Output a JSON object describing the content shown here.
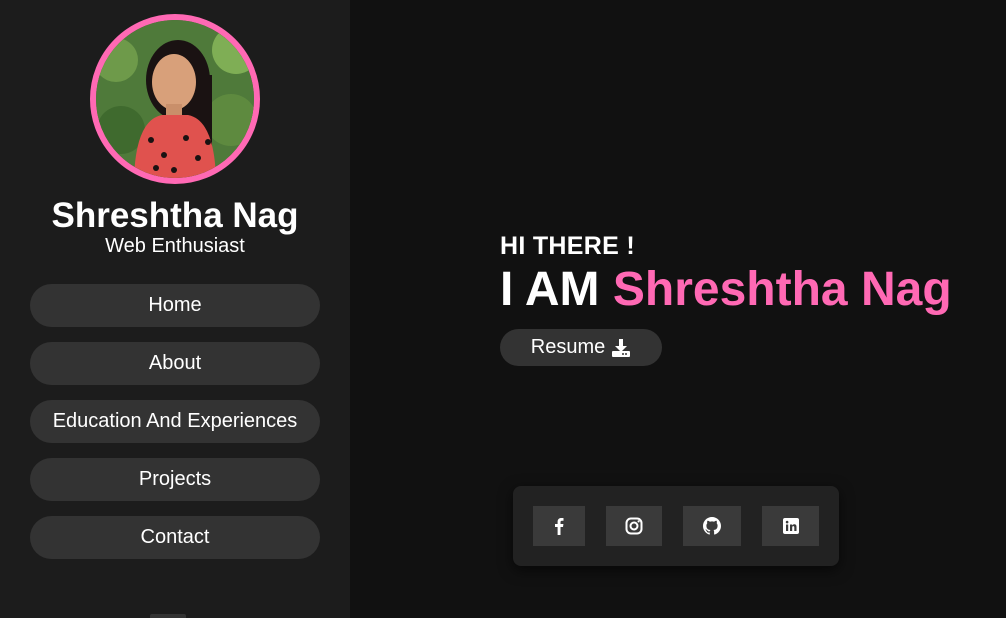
{
  "profile": {
    "name": "Shreshtha Nag",
    "role": "Web Enthusiast",
    "avatar_icon": "profile-photo",
    "accent_color": "#ff69b4"
  },
  "nav": {
    "items": [
      {
        "label": "Home"
      },
      {
        "label": "About"
      },
      {
        "label": "Education And Experiences"
      },
      {
        "label": "Projects"
      },
      {
        "label": "Contact"
      }
    ]
  },
  "hero": {
    "greeting": "HI THERE !",
    "intro": "I AM",
    "name": "Shreshtha Nag",
    "resume_label": "Resume",
    "resume_icon": "download-icon"
  },
  "social": {
    "icons": [
      "facebook-icon",
      "instagram-icon",
      "github-icon",
      "linkedin-icon"
    ]
  },
  "colors": {
    "background": "#111111",
    "sidebar": "#1c1c1c",
    "button": "#333333",
    "accent": "#ff69b4"
  }
}
